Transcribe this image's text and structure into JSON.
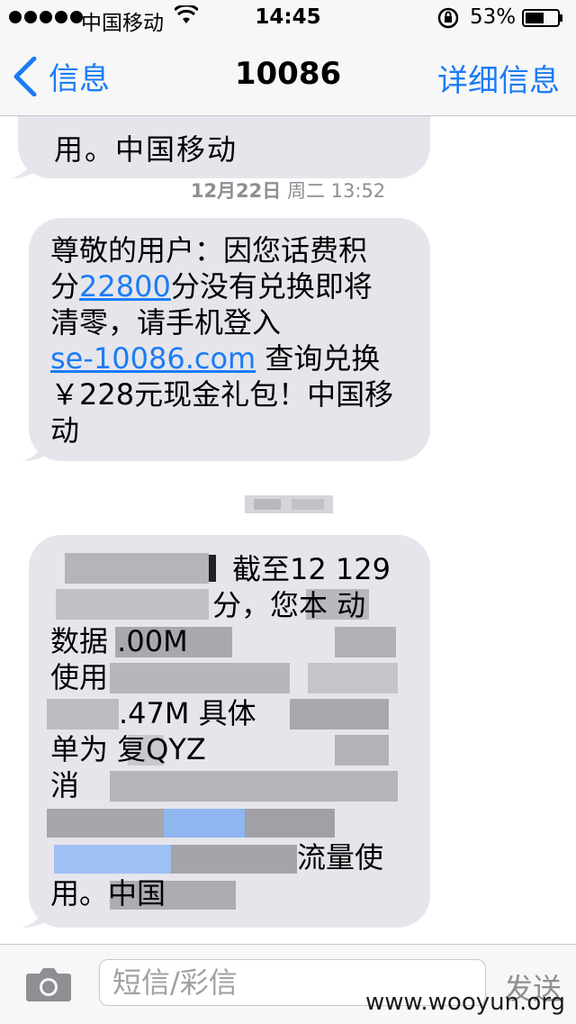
{
  "status_bar": {
    "carrier": "中国移动",
    "time": "14:45",
    "battery": "53%"
  },
  "nav": {
    "back_label": "信息",
    "title": "10086",
    "details_label": "详细信息"
  },
  "messages": {
    "partial_text": "用。中国移动",
    "timestamp_date": "12月22日",
    "timestamp_rest": "周二 13:52",
    "message_2": {
      "line1": "尊敬的用户：因您话费积",
      "line2_pre": "分",
      "line2_link": "22800",
      "line2_post": "分没有兑换即将",
      "line3": "清零，请手机登入",
      "line4_link": "se-10086.com",
      "line4_post": " 查询兑换",
      "line5": "￥228元现金礼包！中国移",
      "line6": "动"
    },
    "message_3_visible": {
      "r1": "截至12 129",
      "r2": "分，您本 动",
      "r3": "数据 .00M",
      "r4": "使用",
      "r5": ".47M 具体",
      "r6": "单为 复QYZ",
      "r7": "消",
      "r9": "流量使",
      "r10": "用。中国"
    }
  },
  "input_bar": {
    "placeholder": "短信/彩信",
    "send_label": "发送"
  },
  "watermark": "www.wooyun.org"
}
